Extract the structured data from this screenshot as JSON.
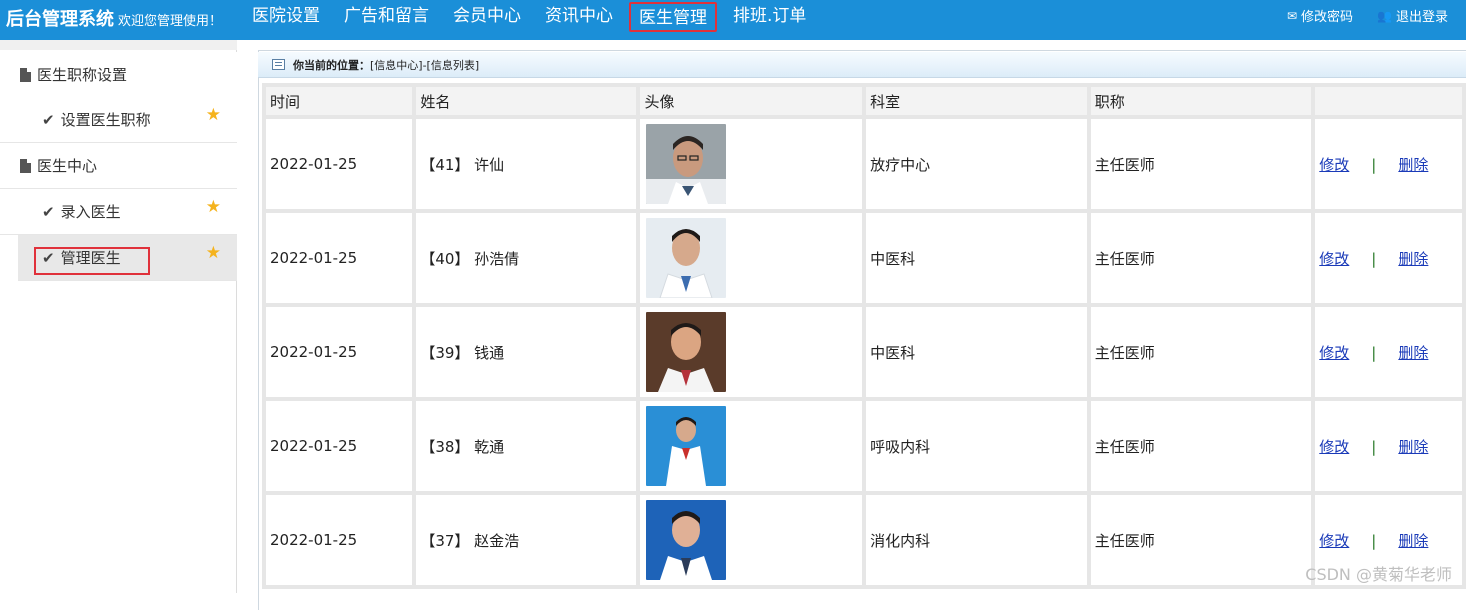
{
  "header": {
    "title": "后台管理系统",
    "welcome": "欢迎您管理使用！",
    "nav": [
      {
        "label": "医院设置"
      },
      {
        "label": "广告和留言"
      },
      {
        "label": "会员中心"
      },
      {
        "label": "资讯中心"
      },
      {
        "label": "医生管理"
      },
      {
        "label": "排班.订单"
      }
    ],
    "change_password": "修改密码",
    "logout": "退出登录"
  },
  "sidebar": {
    "groups": [
      {
        "title": "医生职称设置",
        "items": [
          {
            "label": "设置医生职称"
          }
        ]
      },
      {
        "title": "医生中心",
        "items": [
          {
            "label": "录入医生"
          },
          {
            "label": "管理医生"
          }
        ]
      }
    ]
  },
  "breadcrumb": {
    "label": "你当前的位置：",
    "path": "[信息中心]-[信息列表]"
  },
  "table": {
    "columns": [
      "时间",
      "姓名",
      "头像",
      "科室",
      "职称",
      ""
    ],
    "rows": [
      {
        "time": "2022-01-25",
        "name": "【41】 许仙",
        "dept": "放疗中心",
        "title": "主任医师"
      },
      {
        "time": "2022-01-25",
        "name": "【40】 孙浩倩",
        "dept": "中医科",
        "title": "主任医师"
      },
      {
        "time": "2022-01-25",
        "name": "【39】 钱通",
        "dept": "中医科",
        "title": "主任医师"
      },
      {
        "time": "2022-01-25",
        "name": "【38】 乾通",
        "dept": "呼吸内科",
        "title": "主任医师"
      },
      {
        "time": "2022-01-25",
        "name": "【37】 赵金浩",
        "dept": "消化内科",
        "title": "主任医师"
      }
    ],
    "edit_label": "修改",
    "separator": "|",
    "delete_label": "删除"
  },
  "watermark": "CSDN @黄菊华老师",
  "colors": {
    "topbar": "#1b8fd8",
    "highlight": "#e0313b",
    "star": "#f5b31d",
    "link": "#1a3ab8"
  }
}
